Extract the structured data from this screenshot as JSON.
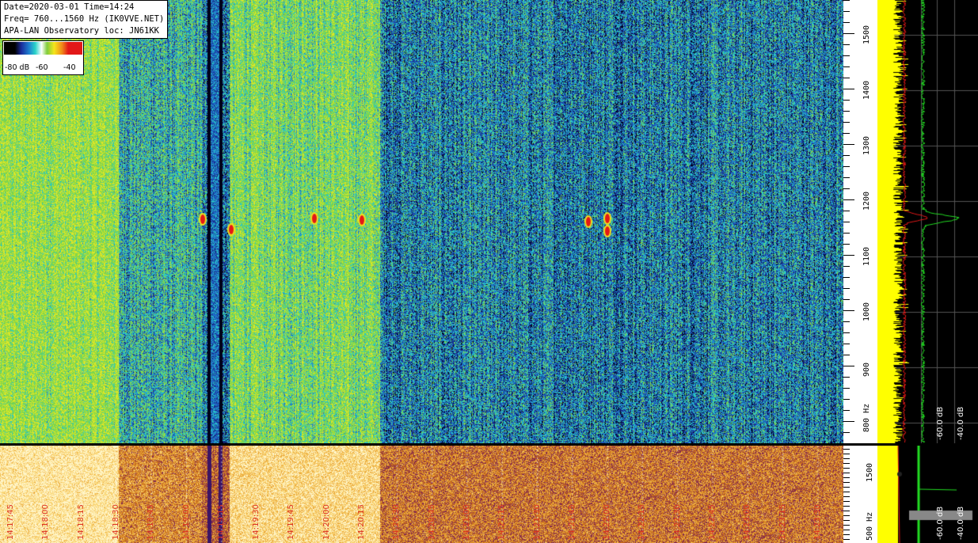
{
  "info": {
    "line1": "Date=2020-03-01 Time=14:24",
    "line2": "Freq= 760...1560 Hz (IK0VVE.NET)",
    "line3": "APA-LAN Observatory loc: JN61KK"
  },
  "legend": {
    "l1": "-80 dB",
    "l2": "-60",
    "l3": "-40"
  },
  "freq_axis_top": {
    "labels": [
      "1500",
      "1400",
      "1300",
      "1200",
      "1100",
      "1000",
      "900",
      "800 Hz"
    ],
    "values": [
      1500,
      1400,
      1300,
      1200,
      1100,
      1000,
      900,
      800
    ],
    "range_hz": [
      760,
      1560
    ]
  },
  "freq_axis_bottom": {
    "labels": [
      "1500",
      "500 Hz"
    ]
  },
  "spectrum_db_labels_top": [
    "-60.0 dB",
    "-40.0 dB"
  ],
  "spectrum_db_labels_bottom": [
    "-60.0 dB",
    "-40.0 dB"
  ],
  "time_labels": [
    "14:17:45",
    "14:18:00",
    "14:18:15",
    "14:18:30",
    "14:18:45",
    "14:19:00",
    "14:19:15",
    "14:19:30",
    "14:19:45",
    "14:20:00",
    "14:20:15",
    "14:20:30",
    "14:20:45",
    "14:21:00",
    "14:21:15",
    "14:21:30",
    "14:21:45",
    "14:22:00",
    "14:22:15",
    "14:22:30",
    "14:22:45",
    "14:23:00",
    "14:23:15",
    "14:23:30"
  ],
  "colors": {
    "waterfall_green": "#7fcc3c",
    "waterfall_blue": "#1c4a9a",
    "meteor_red": "#e21818",
    "spectrum_yellow": "#ffff00",
    "spectrum_green": "#22dd22"
  }
}
